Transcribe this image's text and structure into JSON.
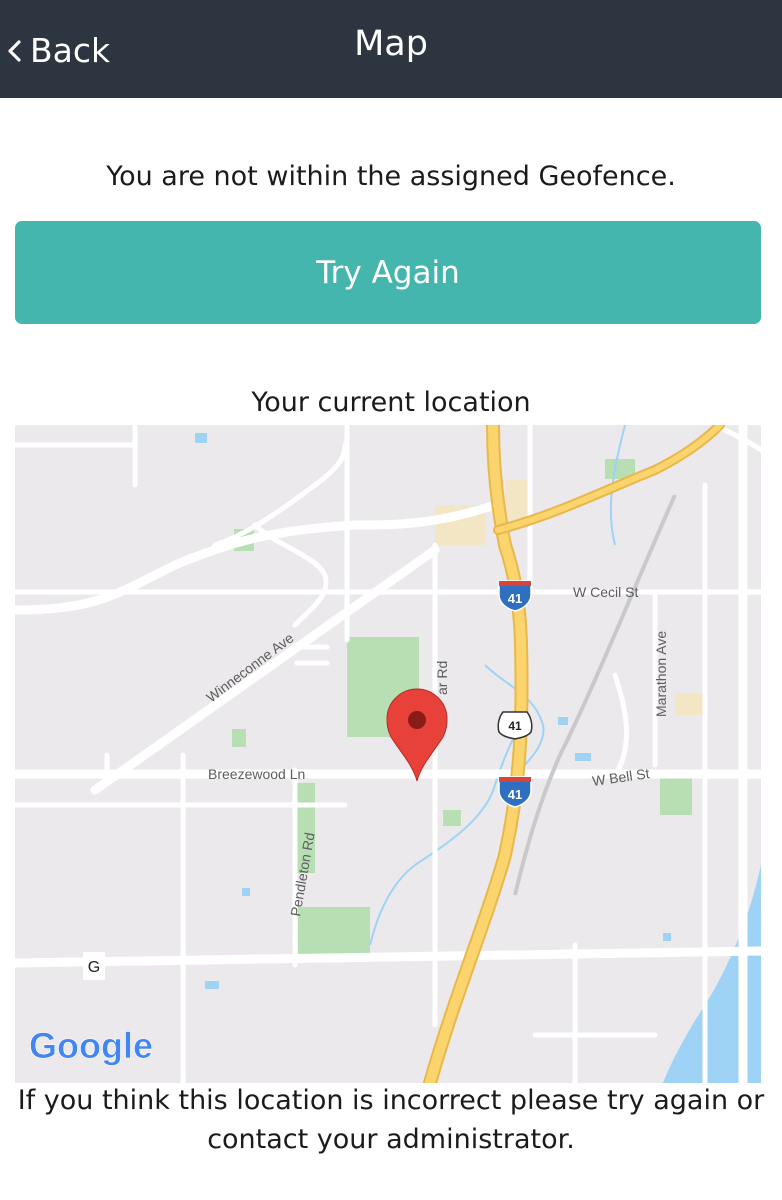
{
  "header": {
    "back_label": "Back",
    "title": "Map",
    "background": "#2c3540"
  },
  "status": {
    "message": "You are not within the assigned Geofence."
  },
  "actions": {
    "try_again_label": "Try Again",
    "accent_color": "#45b6ad"
  },
  "location": {
    "heading": "Your current location"
  },
  "map": {
    "provider_logo": "Google",
    "marker_icon": "map-pin-icon",
    "labels": {
      "cecil": "W Cecil St",
      "marathon": "Marathon Ave",
      "winneconne": "Winneconne Ave",
      "breezewood": "Breezewood Ln",
      "bell": "W Bell St",
      "pendleton": "Pendleton Rd",
      "partial_rd": "ar Rd",
      "g_marker": "G",
      "interstate_shield": "41",
      "us_shield": "41"
    }
  },
  "footer": {
    "note": "If you think this location is incorrect please try again or contact your administrator."
  }
}
